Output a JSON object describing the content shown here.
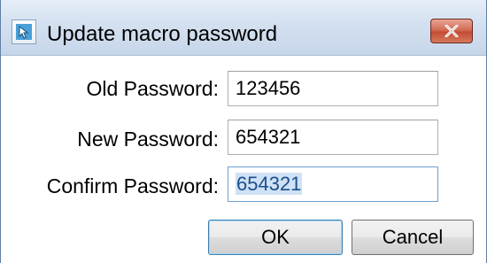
{
  "window": {
    "title": "Update macro password",
    "icon": "app-icon",
    "close_icon": "close-x-icon"
  },
  "form": {
    "old_password": {
      "label": "Old Password:",
      "value": "123456"
    },
    "new_password": {
      "label": "New Password:",
      "value": "654321"
    },
    "confirm_password": {
      "label": "Confirm Password:",
      "value": "654321",
      "focused": true,
      "text_selected": true
    }
  },
  "buttons": {
    "ok_label": "OK",
    "cancel_label": "Cancel"
  },
  "colors": {
    "titlebar": "#d3e0f0",
    "close_button": "#c34d34",
    "selection_background": "#cfe1f5",
    "selection_text": "#1a4f8c"
  }
}
